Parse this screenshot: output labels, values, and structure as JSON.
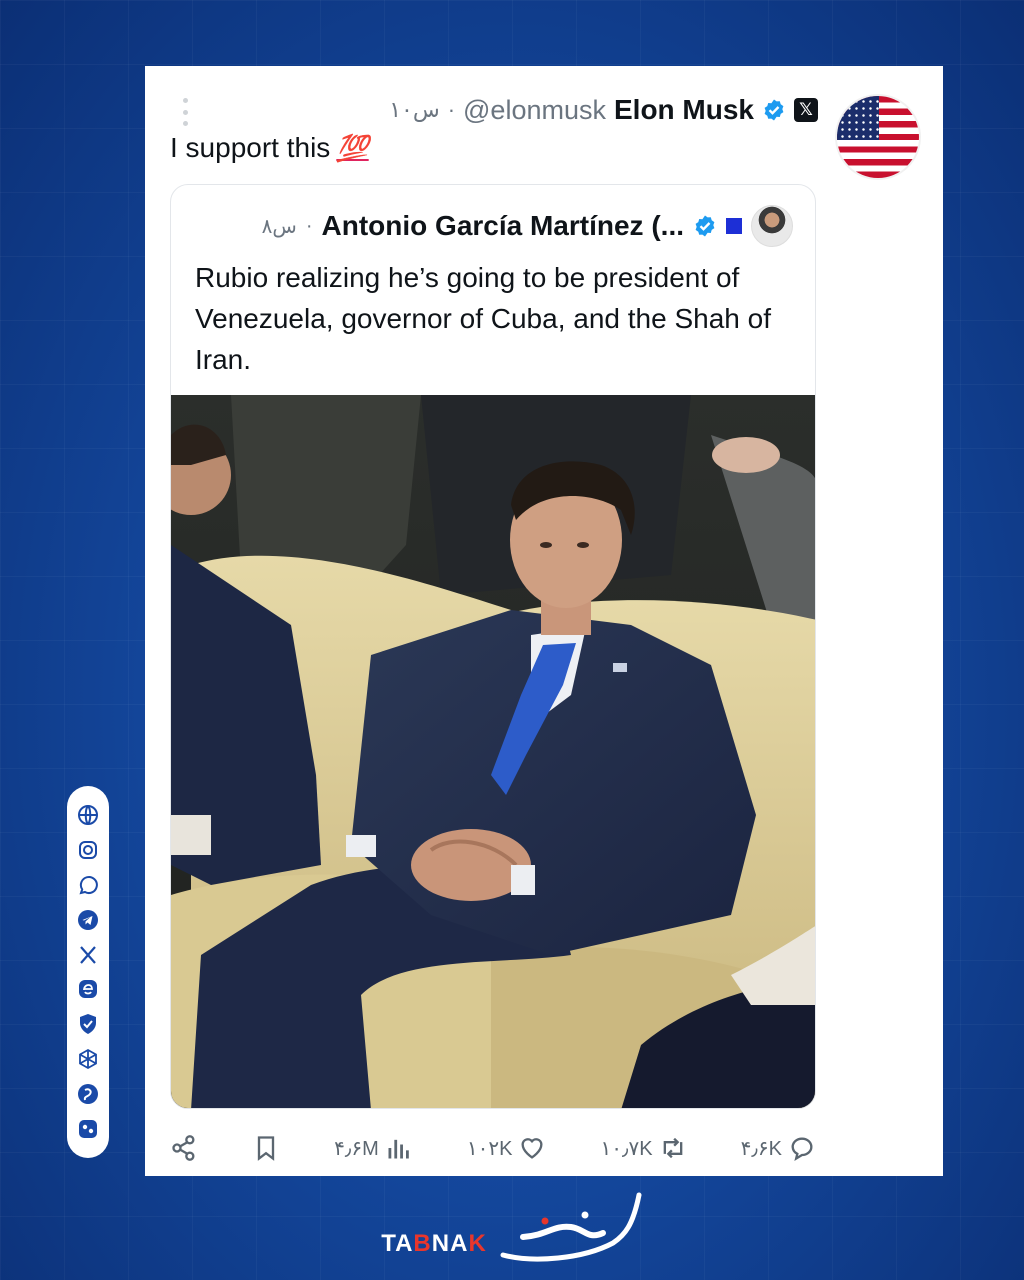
{
  "tweet": {
    "author_name": "Elon Musk",
    "handle": "@elonmusk",
    "separator": "·",
    "time": "۱۰س",
    "text": "I support this",
    "emoji": "💯"
  },
  "quoted_tweet": {
    "author_name": "Antonio García Martínez (...",
    "separator": "·",
    "time": "۸س",
    "text": "Rubio realizing he’s going to be president of Venezuela, governor of Cuba, and the Shah of Iran."
  },
  "actions": {
    "views": "۴٫۶M",
    "likes": "۱۰۲K",
    "reposts": "۱۰٫۷K",
    "replies": "۴٫۶K"
  },
  "brand": {
    "latin_prefix": "TA",
    "latin_accent": "B",
    "latin_mid": "NA",
    "latin_accent2": "K",
    "arabic_name": "تابناک"
  },
  "colors": {
    "background": "#14489e",
    "verified_blue": "#1d9bf0",
    "brand_red": "#e8362c"
  },
  "icons": [
    "us-flag-icon",
    "more-icon",
    "verified-icon",
    "x-logo-icon",
    "share-icon",
    "bookmark-icon",
    "views-icon",
    "like-icon",
    "repost-icon",
    "reply-icon",
    "globe-icon",
    "instagram-icon",
    "whatsapp-icon",
    "telegram-icon",
    "x-icon",
    "eitaa-icon",
    "bale-icon",
    "rubika-icon",
    "soroush-icon",
    "igap-icon"
  ]
}
